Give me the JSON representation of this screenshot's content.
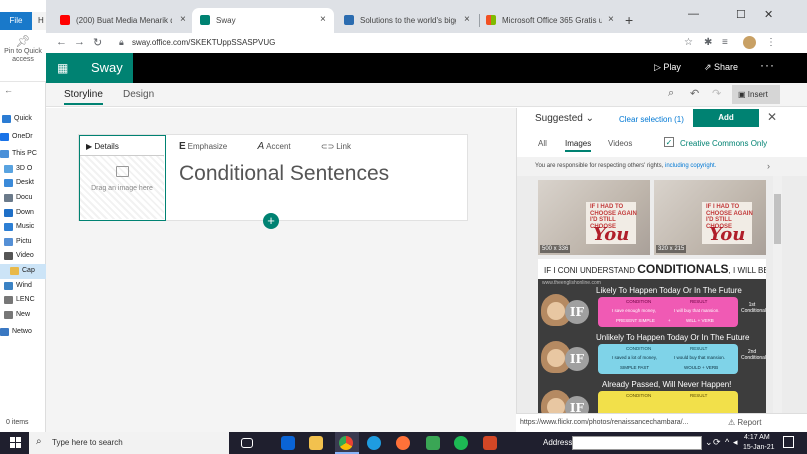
{
  "explorer": {
    "file_tab": "File",
    "home_tab_partial": "H",
    "pin_label": "Pin to Quick access",
    "tree": [
      {
        "label": "Quick",
        "color": "#2b7cd3"
      },
      {
        "label": "OneDr",
        "color": "#1a73e8"
      },
      {
        "label": "This PC",
        "color": "#4a90d9"
      },
      {
        "label": "3D O",
        "color": "#59a3e0"
      },
      {
        "label": "Deskt",
        "color": "#3b8ad9"
      },
      {
        "label": "Docu",
        "color": "#6b7a8a"
      },
      {
        "label": "Down",
        "color": "#1f6fc7"
      },
      {
        "label": "Music",
        "color": "#2d7fd4"
      },
      {
        "label": "Pictu",
        "color": "#5590d6"
      },
      {
        "label": "Video",
        "color": "#555555"
      },
      {
        "label": "Cap",
        "color": "#e8b94a"
      },
      {
        "label": "Wind",
        "color": "#3b82c4"
      },
      {
        "label": "LENC",
        "color": "#777777"
      },
      {
        "label": "New",
        "color": "#777777"
      },
      {
        "label": "Netwo",
        "color": "#3a78c2"
      }
    ],
    "item_count": "0 items"
  },
  "browser": {
    "tabs": [
      {
        "title": "(200) Buat Media Menarik dan In",
        "favicon_color": "#ff0000"
      },
      {
        "title": "Sway",
        "favicon_color": "#008272"
      },
      {
        "title": "Solutions to the world's biggest",
        "favicon_color": "#2b6cb0"
      },
      {
        "title": "Microsoft Office 365 Gratis untuk",
        "favicon_color": "#f25022"
      }
    ],
    "url": "sway.office.com/SKEKTUppSSASPVUG"
  },
  "sway": {
    "brand": "Sway",
    "play_label": "Play",
    "share_label": "Share",
    "storyline_tab": "Storyline",
    "design_tab": "Design",
    "insert_label": "Insert",
    "card": {
      "details_label": "Details",
      "dropzone_text": "Drag an image here",
      "emphasize_label": "Emphasize",
      "accent_label": "Accent",
      "link_label": "Link",
      "heading": "Conditional Sentences"
    }
  },
  "panel": {
    "suggested_label": "Suggested",
    "clear_selection": "Clear selection (1)",
    "add_label": "Add",
    "tabs": {
      "all": "All",
      "images": "Images",
      "videos": "Videos"
    },
    "creative_commons": "Creative Commons Only",
    "notice": "You are responsible for respecting others' rights, including copyright.",
    "notice_link": "including copyright.",
    "notice_lead": "You are responsible for respecting others' rights, ",
    "results": [
      {
        "sign_text": "IF I HAD TO\nCHOOSE AGAIN\nI'D STILL\nCHOOSE",
        "big": "You",
        "dim": "500 x 336",
        "selected": true
      },
      {
        "sign_text": "IF I HAD TO\nCHOOSE AGAIN\nI'D STILL\nCHOOSE",
        "big": "You",
        "dim": "320 x 215",
        "selected": false
      }
    ],
    "infographic": {
      "head_prefix": "IF I CONI UNDERSTAND",
      "head_big": "CONDITIONALS",
      "head_suffix": ", I WILL BE HAPPY",
      "url": "www.theenglishonline.com",
      "bands": [
        {
          "title": "Likely To Happen Today Or In The Future",
          "box_color": "#f05ab4",
          "condition": "CONDITION",
          "result": "RESULT",
          "example_left": "I save enough money,",
          "example_right": "I will buy that mansion.",
          "form_left": "PRESENT SIMPLE",
          "form_mid": "+",
          "form_right": "WILL + VERB",
          "side": "1st Conditional"
        },
        {
          "title": "Unlikely To Happen Today Or In The Future",
          "box_color": "#7fd3e8",
          "condition": "CONDITION",
          "result": "RESULT",
          "example_left": "I saved a lot of money,",
          "example_right": "I would buy that mansion.",
          "form_left": "SIMPLE PAST",
          "form_mid": "",
          "form_right": "WOULD + VERB",
          "side": "2nd Conditional"
        },
        {
          "title": "Already Passed, Will Never Happen!",
          "box_color": "#f2e04a",
          "condition": "CONDITION",
          "result": "RESULT"
        }
      ]
    },
    "footer_url": "https://www.flickr.com/photos/renaissancechambara/...",
    "report_label": "Report"
  },
  "taskbar": {
    "search_placeholder": "Type here to search",
    "address_label": "Address",
    "time": "4:17 AM",
    "date": "15-Jan-21",
    "apps": [
      {
        "name": "task-view-icon",
        "color": "#ffffff"
      },
      {
        "name": "mail-icon",
        "color": "#0a64d6"
      },
      {
        "name": "file-explorer-icon",
        "color": "#f2c14e"
      },
      {
        "name": "chrome-icon",
        "color": "#34a853"
      },
      {
        "name": "edge-icon",
        "color": "#1f9ce0"
      },
      {
        "name": "firefox-icon",
        "color": "#ff7139"
      },
      {
        "name": "app-green-icon",
        "color": "#3aa655"
      },
      {
        "name": "spotify-icon",
        "color": "#1db954"
      },
      {
        "name": "powerpoint-icon",
        "color": "#d24726"
      }
    ]
  }
}
